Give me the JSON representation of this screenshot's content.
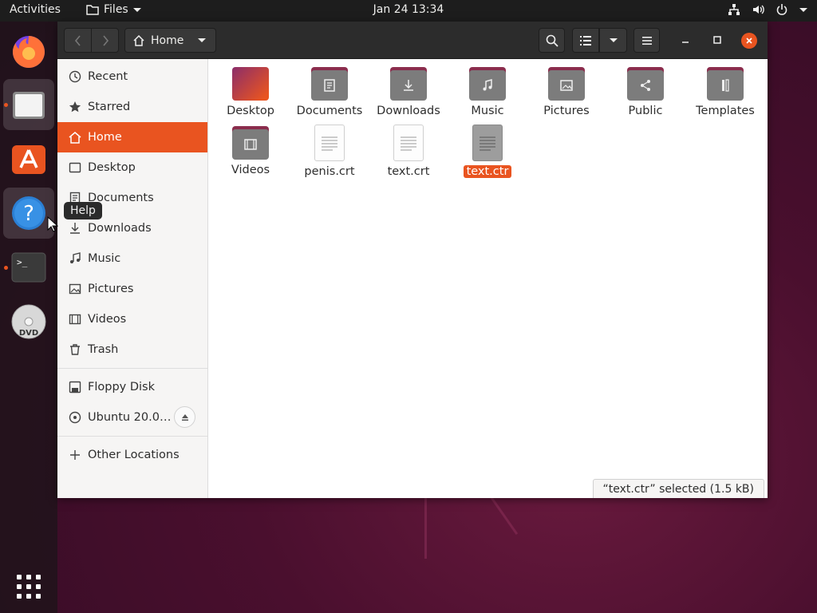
{
  "topbar": {
    "activities": "Activities",
    "app_name": "Files",
    "clock": "Jan 24  13:34"
  },
  "dock": {
    "tooltip": "Help",
    "items": [
      "firefox-icon",
      "files-icon",
      "ubuntu-software-icon",
      "help-icon",
      "terminal-icon",
      "dvd-icon"
    ]
  },
  "headerbar": {
    "path_label": "Home"
  },
  "sidebar": {
    "items": [
      {
        "label": "Recent",
        "icon": "clock-icon"
      },
      {
        "label": "Starred",
        "icon": "star-icon"
      },
      {
        "label": "Home",
        "icon": "home-icon",
        "selected": true
      },
      {
        "label": "Desktop",
        "icon": "desktop-icon"
      },
      {
        "label": "Documents",
        "icon": "document-icon"
      },
      {
        "label": "Downloads",
        "icon": "download-icon"
      },
      {
        "label": "Music",
        "icon": "music-icon"
      },
      {
        "label": "Pictures",
        "icon": "picture-icon"
      },
      {
        "label": "Videos",
        "icon": "video-icon"
      },
      {
        "label": "Trash",
        "icon": "trash-icon"
      }
    ],
    "devices": [
      {
        "label": "Floppy Disk",
        "icon": "floppy-icon"
      },
      {
        "label": "Ubuntu 20.0…",
        "icon": "disc-icon"
      }
    ],
    "other_locations": "Other Locations"
  },
  "files": [
    {
      "label": "Desktop",
      "kind": "desktop-folder"
    },
    {
      "label": "Documents",
      "kind": "folder"
    },
    {
      "label": "Downloads",
      "kind": "folder"
    },
    {
      "label": "Music",
      "kind": "folder"
    },
    {
      "label": "Pictures",
      "kind": "folder"
    },
    {
      "label": "Public",
      "kind": "folder"
    },
    {
      "label": "Templates",
      "kind": "folder"
    },
    {
      "label": "Videos",
      "kind": "folder"
    },
    {
      "label": "penis.crt",
      "kind": "file"
    },
    {
      "label": "text.crt",
      "kind": "file"
    },
    {
      "label": "text.ctr",
      "kind": "file",
      "selected": true
    }
  ],
  "status": "“text.ctr” selected  (1.5 kB)",
  "colors": {
    "accent": "#e95420",
    "headerbar": "#2c2c2c",
    "folder": "#7c7c7c"
  }
}
